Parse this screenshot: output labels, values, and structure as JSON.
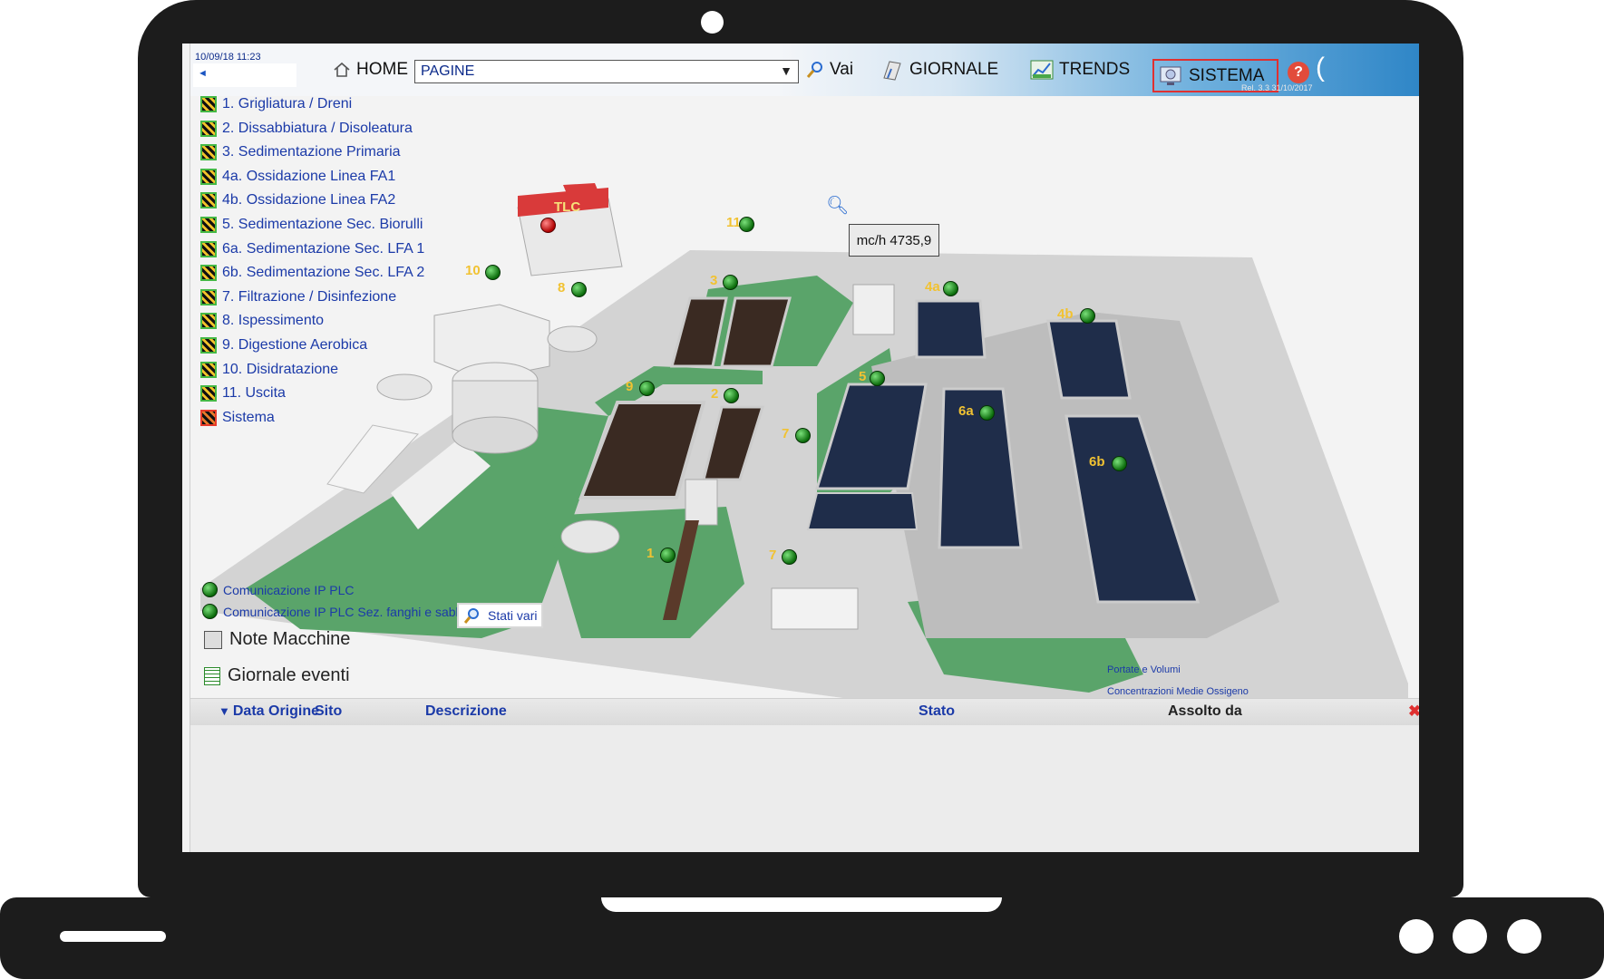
{
  "header": {
    "timestamp": "10/09/18 11:23",
    "back_arrow": "◄",
    "home_label": "HOME",
    "pages_select_value": "PAGINE",
    "vai_label": "Vai",
    "giornale_label": "GIORNALE",
    "trends_label": "TRENDS",
    "sistema_label": "SISTEMA",
    "release": "Rel. 3.3 31/10/2017"
  },
  "menu": [
    {
      "label": "1. Grigliatura / Dreni",
      "status": "ok"
    },
    {
      "label": "2. Dissabbiatura / Disoleatura",
      "status": "ok"
    },
    {
      "label": "3. Sedimentazione Primaria",
      "status": "ok"
    },
    {
      "label": "4a. Ossidazione Linea FA1",
      "status": "ok"
    },
    {
      "label": "4b. Ossidazione Linea FA2",
      "status": "ok"
    },
    {
      "label": "5. Sedimentazione Sec. Biorulli",
      "status": "ok"
    },
    {
      "label": "6a. Sedimentazione Sec. LFA 1",
      "status": "ok"
    },
    {
      "label": "6b. Sedimentazione Sec. LFA 2",
      "status": "ok"
    },
    {
      "label": "7. Filtrazione / Disinfezione",
      "status": "ok"
    },
    {
      "label": "8. Ispessimento",
      "status": "ok"
    },
    {
      "label": "9. Digestione Aerobica",
      "status": "ok"
    },
    {
      "label": "10. Disidratazione",
      "status": "ok"
    },
    {
      "label": "11. Uscita",
      "status": "ok"
    },
    {
      "label": "Sistema",
      "status": "alarm"
    }
  ],
  "plant": {
    "tlc_label": "TLC",
    "flow_reading": "mc/h 4735,9",
    "markers": [
      "11",
      "10",
      "8",
      "3",
      "9",
      "2",
      "1",
      "7",
      "7",
      "5",
      "4a",
      "4b",
      "6a",
      "6b"
    ],
    "links": {
      "portate": "Portate e Volumi",
      "ossigeno": "Concentrazioni Medie Ossigeno"
    }
  },
  "legend": {
    "plc": "Comunicazione IP PLC",
    "plc_fanghi": "Comunicazione IP PLC Sez. fanghi e sabbie",
    "stati_vari": "Stati vari",
    "note_macchine": "Note Macchine",
    "giornale_eventi": "Giornale eventi"
  },
  "events_table": {
    "columns": [
      "Data Origine",
      "Sito",
      "Descrizione",
      "Stato",
      "Assolto da"
    ]
  },
  "colors": {
    "ok_status": "#45b845",
    "alarm_status": "#e83a2a",
    "link_text": "#1b3aa8",
    "grass": "#5aa46a",
    "pavement": "#cfcfcf",
    "sludge_tank": "#3a2a22",
    "water_tank": "#1f2d4a"
  }
}
